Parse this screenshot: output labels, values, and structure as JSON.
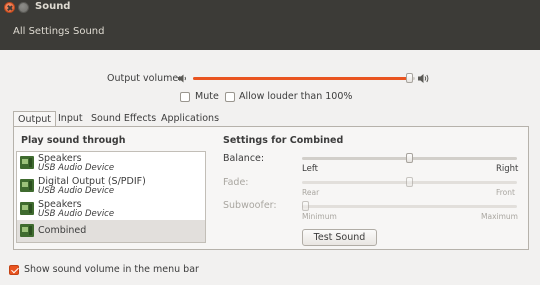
{
  "window": {
    "title": "Sound"
  },
  "toolbar": {
    "all_settings": "All Settings",
    "sound": "Sound"
  },
  "output_volume": {
    "label": "Output volume:",
    "level": 0.99
  },
  "mute": {
    "label": "Mute",
    "checked": false
  },
  "louder": {
    "label": "Allow louder than 100%",
    "checked": false
  },
  "tabs": [
    {
      "label": "Output",
      "active": true
    },
    {
      "label": "Input",
      "active": false
    },
    {
      "label": "Sound Effects",
      "active": false
    },
    {
      "label": "Applications",
      "active": false
    }
  ],
  "play_through": {
    "heading": "Play sound through",
    "devices": [
      {
        "name": "Speakers",
        "sub": "USB Audio Device",
        "selected": false
      },
      {
        "name": "Digital Output (S/PDIF)",
        "sub": "USB Audio Device",
        "selected": false
      },
      {
        "name": "Speakers",
        "sub": "USB Audio Device",
        "selected": false
      },
      {
        "name": "Combined",
        "sub": "",
        "selected": true
      }
    ]
  },
  "settings": {
    "heading": "Settings for Combined",
    "balance": {
      "label": "Balance:",
      "left": "Left",
      "right": "Right",
      "level": 0.5
    },
    "fade": {
      "label": "Fade:",
      "left": "Rear",
      "right": "Front",
      "level": 0.5
    },
    "subwoofer": {
      "label": "Subwoofer:",
      "left": "Minimum",
      "right": "Maximum",
      "level": 0.0
    },
    "test_button": "Test Sound"
  },
  "show_volume": {
    "label": "Show sound volume in the menu bar",
    "checked": true
  }
}
